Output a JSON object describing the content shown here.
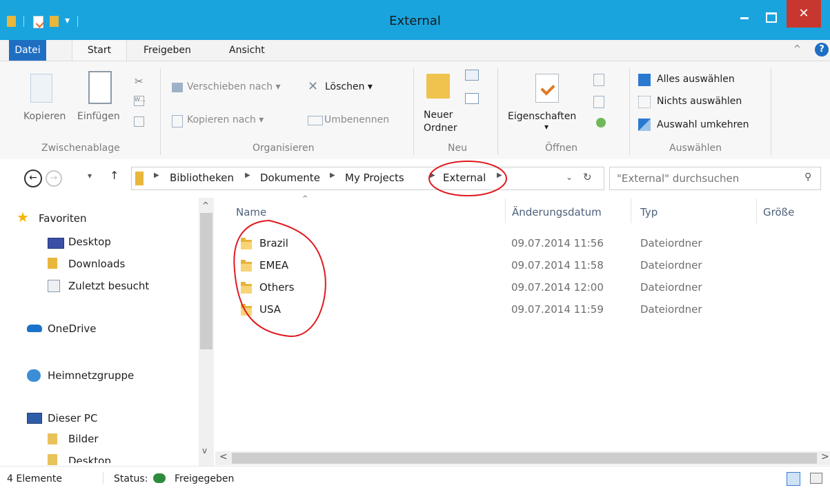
{
  "window": {
    "title": "External"
  },
  "quick_access_icons": [
    "properties-icon",
    "new-folder-icon",
    "customize-dropdown-icon"
  ],
  "ribbon_tabs": [
    "Datei",
    "Start",
    "Freigeben",
    "Ansicht"
  ],
  "ribbon": {
    "clipboard": {
      "copy": "Kopieren",
      "paste": "Einfügen",
      "group": "Zwischenablage"
    },
    "organize": {
      "move_to": "Verschieben nach",
      "copy_to": "Kopieren nach",
      "delete": "Löschen",
      "rename": "Umbenennen",
      "group": "Organisieren"
    },
    "new": {
      "new_folder_line1": "Neuer",
      "new_folder_line2": "Ordner",
      "group": "Neu"
    },
    "open": {
      "properties": "Eigenschaften",
      "group": "Öffnen"
    },
    "select": {
      "select_all": "Alles auswählen",
      "select_none": "Nichts auswählen",
      "invert": "Auswahl umkehren",
      "group": "Auswählen"
    }
  },
  "address": {
    "breadcrumb": [
      "Bibliotheken",
      "Dokumente",
      "My Projects",
      "External"
    ],
    "search_placeholder": "\"External\" durchsuchen"
  },
  "nav": {
    "favorites": "Favoriten",
    "items": [
      "Desktop",
      "Downloads",
      "Zuletzt besucht"
    ],
    "onedrive": "OneDrive",
    "homegroup": "Heimnetzgruppe",
    "this_pc": "Dieser PC",
    "pc_items": [
      "Bilder",
      "Desktop"
    ]
  },
  "list": {
    "columns": [
      "Name",
      "Änderungsdatum",
      "Typ",
      "Größe"
    ],
    "rows": [
      {
        "name": "Brazil",
        "date": "09.07.2014 11:56",
        "type": "Dateiordner"
      },
      {
        "name": "EMEA",
        "date": "09.07.2014 11:58",
        "type": "Dateiordner"
      },
      {
        "name": "Others",
        "date": "09.07.2014 12:00",
        "type": "Dateiordner"
      },
      {
        "name": "USA",
        "date": "09.07.2014 11:59",
        "type": "Dateiordner"
      }
    ]
  },
  "status": {
    "count": "4 Elemente",
    "status_label": "Status:",
    "status_value": "Freigegeben"
  },
  "colors": {
    "titlebar": "#19a4de",
    "close": "#c7372f",
    "accent_tab": "#1e6fc2",
    "annotation": "#e0191e"
  }
}
